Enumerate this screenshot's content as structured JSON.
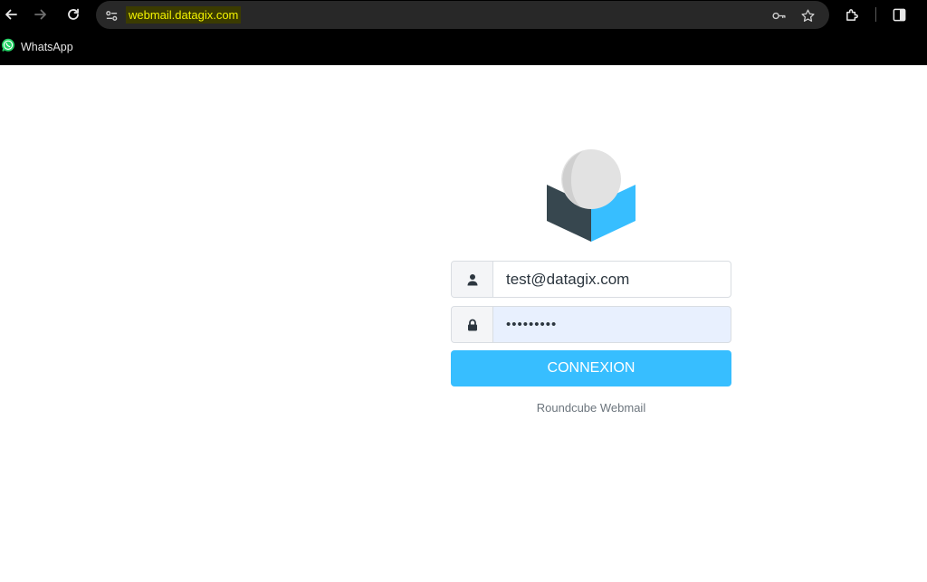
{
  "browser": {
    "url": "webmail.datagix.com",
    "bookmarks": [
      {
        "label": "WhatsApp",
        "icon": "whatsapp-icon",
        "color": "#25d366"
      }
    ]
  },
  "login": {
    "username_value": "test@datagix.com",
    "password_value": "•••••••••",
    "submit_label": "CONNEXION",
    "footer_text": "Roundcube Webmail"
  },
  "colors": {
    "accent": "#37beff",
    "url_highlight": "#f4f400"
  }
}
